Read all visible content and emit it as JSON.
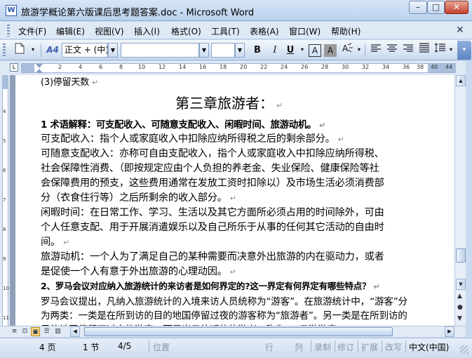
{
  "window": {
    "title": "旅游学概论第六版课后思考题答案.doc - Microsoft Word",
    "app_icon_glyph": "W",
    "minimize_glyph": "–",
    "maximize_glyph": "□",
    "close_glyph": "✕"
  },
  "menu": {
    "items": [
      "文件(F)",
      "编辑(E)",
      "视图(V)",
      "插入(I)",
      "格式(O)",
      "工具(T)",
      "表格(A)",
      "窗口(W)",
      "帮助(H)"
    ],
    "close_glyph": "✕"
  },
  "toolbar": {
    "style_icon": "A4",
    "style_value": "正文 + (中)",
    "font_value": "",
    "size_value": "",
    "bold": "B",
    "italic": "I",
    "underline": "U",
    "char_border": "A",
    "char_shade": "A",
    "end_glyph": "▾"
  },
  "ruler": {
    "corner": "L",
    "labels": [
      "2",
      "4",
      "6",
      "8",
      "10",
      "12",
      "14",
      "16",
      "18",
      "20",
      "22",
      "24",
      "26",
      "28",
      "30",
      "32",
      "34",
      "36",
      "38",
      "40",
      "44"
    ]
  },
  "vruler": {
    "labels": [
      "4",
      "5",
      "6",
      "7",
      "8",
      "9",
      "10",
      "11"
    ]
  },
  "document": {
    "cut_line": "(3)停留天数",
    "chapter_title": "第三章旅游者：",
    "lines": [
      "1 术语解释：可支配收入、可随意支配收入、闲暇时间、旅游动机。",
      "可支配收入：指个人或家庭收入中扣除应纳所得税之后的剩余部分。",
      "可随意支配收入：亦称可自由支配收入，指个人或家庭收入中扣除应纳所得税、",
      "社会保障性消费、（即按规定应由个人负担的养老金、失业保险、健康保险等社",
      "会保障费用的预支，这些费用通常在发放工资时扣除以）及市场生活必须消费部",
      "分（衣食住行等）之后所剩余的收入部分。",
      "闲暇时间：在日常工作、学习、生活以及其它方面所必须占用的时间除外，可由",
      "个人任意支配、用于开展消遣娱乐以及自己所乐于从事的任何其它活动的自由时",
      "间。",
      "旅游动机：一个人为了满足自己的某种需要而决意外出旅游的内在驱动力，或者",
      "是促使一个人有意于外出旅游的心理动因。",
      "2、罗马会议对应纳入旅游统计的来访者是如何界定的?这一界定有何界定有哪些特点？",
      "罗马会议提出，凡纳入旅游统计的入境来访人员统称为“游客”。在旅游统计中，“游客”分",
      "为两类：一类是在所到访的目的地国停留过夜的游客称为“旅游者”。另一类是在所到访的",
      "目的地国停留不过夜的游客，而是当日往返的旅游者，称为“一日游游客”"
    ],
    "para_mark": "↵"
  },
  "status": {
    "page": "4 页",
    "section": "1 节",
    "page_of": "4/5",
    "position": "位置",
    "line": "行",
    "col": "列",
    "rec": "录制",
    "trk": "修订",
    "ext": "扩展",
    "ovr": "改写",
    "lang": "中文(中国)"
  },
  "icons": {
    "new": "new-document-icon",
    "style": "style-icon",
    "dropdown": "dropdown-arrow-icon",
    "align_left": "align-left-icon",
    "align_center": "align-center-icon",
    "align_right": "align-right-icon",
    "justify": "justify-icon",
    "line_spacing": "line-spacing-icon",
    "highlight": "highlight-icon"
  }
}
